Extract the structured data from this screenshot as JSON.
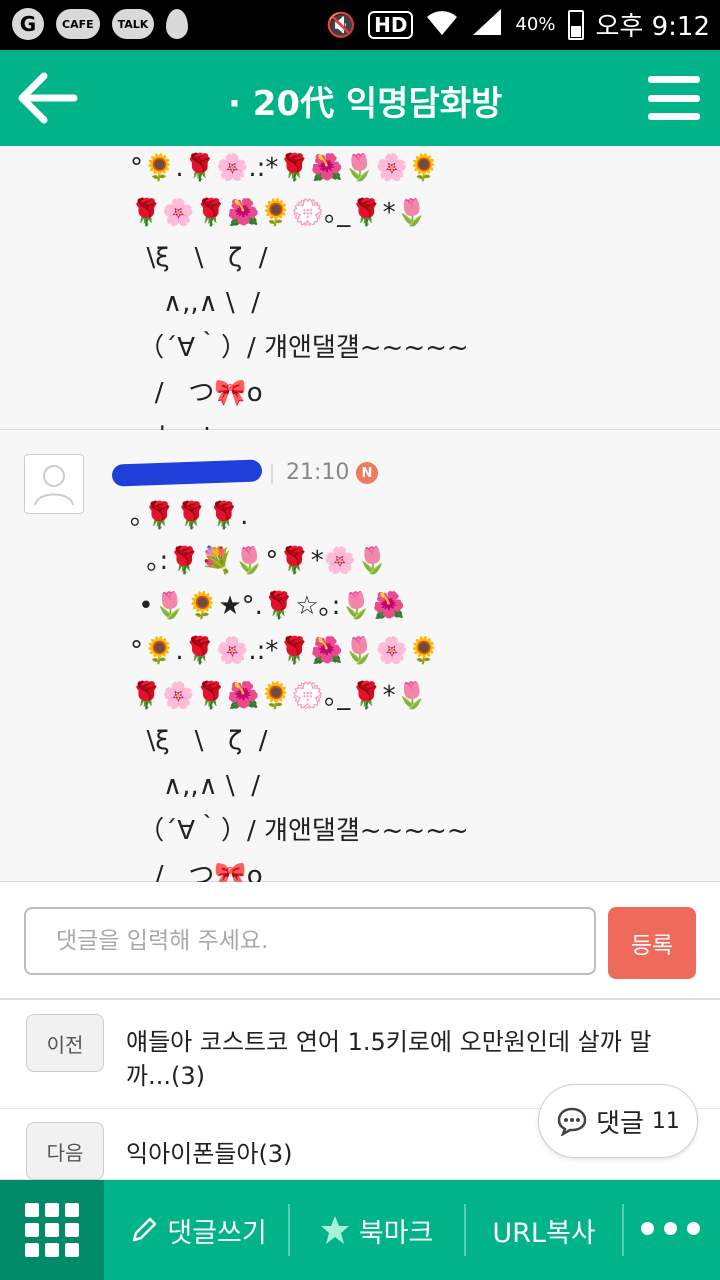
{
  "status_bar": {
    "left_icons": [
      "G",
      "CAFE",
      "TALK"
    ],
    "hd": "HD",
    "battery": "40%",
    "time": "오후 9:12"
  },
  "header": {
    "title": "· 20代 익명담화방"
  },
  "comments": [
    {
      "art": "°🌻.🌹🌸.:*🌹🌺🌷🌸🌻\n🌹🌸🌹🌺🌻💮｡_🌹*🌷\n  \\ξ   \\   ζ  /\n    ∧,,∧ \\  /\n （´∀｀）/ 걔앤댈걜~~~~~\n   /   つ🎀o\n   し-Ｊ"
    },
    {
      "author": "",
      "time": "21:10",
      "badge": "N",
      "art": "｡🌹🌹🌹.\n  ｡:🌹💐🌷°🌹*🌸🌷\n •🌷🌻★°.🌹☆｡:🌷🌺\n°🌻.🌹🌸.:*🌹🌺🌷🌸🌻\n🌹🌸🌹🌺🌻💮｡_🌹*🌷\n  \\ξ   \\   ζ  /\n    ∧,,∧ \\  /\n （´∀｀）/ 걔앤댈걜~~~~~\n   /   つ🎀o\n   し-Ｊ"
    }
  ],
  "comment_input": {
    "placeholder": "댓글을 입력해 주세요.",
    "submit_label": "등록"
  },
  "navigation": {
    "prev": {
      "tag": "이전",
      "title": "얘들아 코스트코 연어 1.5키로에 오만원인데 살까 말까...(3)"
    },
    "next": {
      "tag": "다음",
      "title": "익아이폰들아(3)"
    }
  },
  "floating_comment": {
    "label": "댓글",
    "count": "11"
  },
  "bottom_bar": {
    "write_comment": "댓글쓰기",
    "bookmark": "북마크",
    "copy_url": "URL복사"
  }
}
